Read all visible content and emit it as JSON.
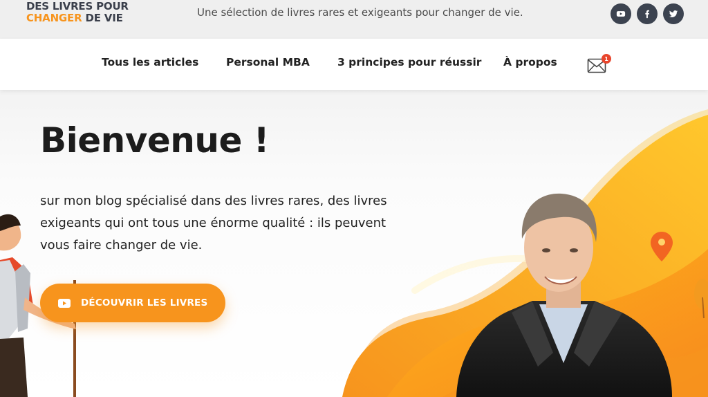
{
  "header": {
    "logo_line1": "DES LIVRES POUR",
    "logo_line2_accent": "CHANGER",
    "logo_line2_rest": " DE VIE",
    "tagline": "Une sélection de livres rares et exigeants pour changer de vie.",
    "social_icons": [
      "youtube-icon",
      "facebook-icon",
      "twitter-icon"
    ]
  },
  "nav": {
    "items": [
      {
        "label": "Tous les articles"
      },
      {
        "label": "Personal MBA"
      },
      {
        "label": "3 principes pour réussir"
      },
      {
        "label": "À propos"
      }
    ],
    "mail_badge": "1"
  },
  "hero": {
    "title": "Bienvenue !",
    "intro": "sur mon blog spécialisé dans des livres rares, des livres exigeants qui ont tous une énorme qualité : ils peuvent vous faire changer de vie.",
    "cta_label": "DÉCOUVRIR LES LIVRES"
  },
  "colors": {
    "accent": "#f7941d",
    "dark": "#3a3f4b",
    "badge": "#e8452c"
  }
}
